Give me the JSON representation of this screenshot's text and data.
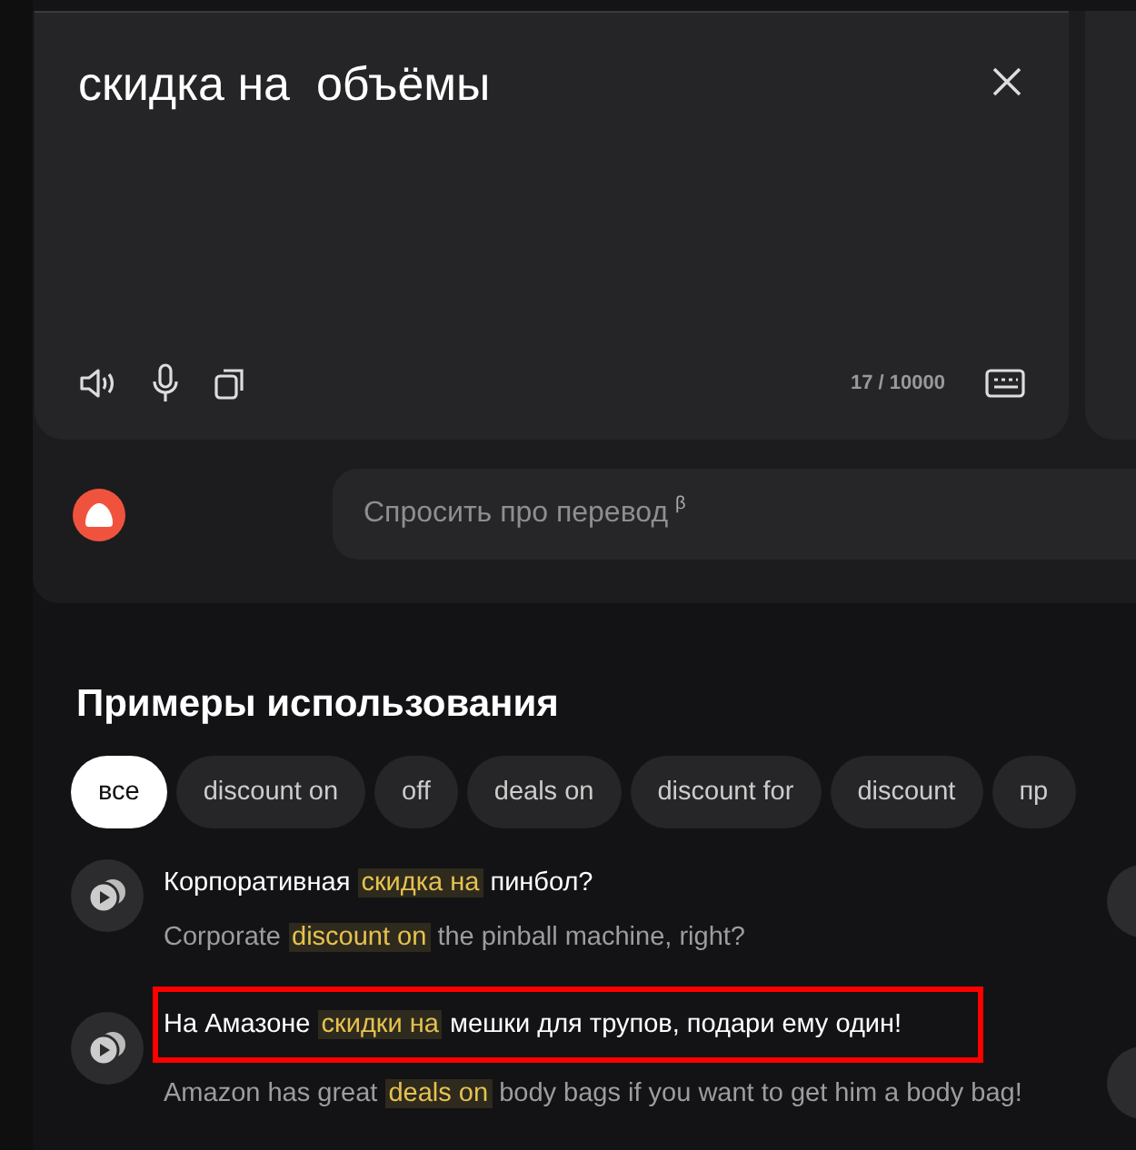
{
  "source": {
    "text": "скидка на  объёмы",
    "counter": "17 / 10000"
  },
  "assistant": {
    "placeholder": "Спросить про перевод",
    "mark": "β"
  },
  "examples_section": {
    "title": "Примеры использования",
    "filters": [
      {
        "label": "все",
        "selected": true
      },
      {
        "label": "discount on",
        "selected": false
      },
      {
        "label": "off",
        "selected": false
      },
      {
        "label": "deals on",
        "selected": false
      },
      {
        "label": "discount for",
        "selected": false
      },
      {
        "label": "discount",
        "selected": false
      },
      {
        "label": "пр",
        "selected": false
      }
    ],
    "examples": [
      {
        "highlighted": false,
        "source": [
          {
            "text": "Корпоративная ",
            "match": false
          },
          {
            "text": "скидка на",
            "match": true
          },
          {
            "text": " пинбол?",
            "match": false
          }
        ],
        "translation": [
          {
            "text": "Corporate ",
            "match": false
          },
          {
            "text": "discount on",
            "match": true
          },
          {
            "text": " the pinball machine, right?",
            "match": false
          }
        ]
      },
      {
        "highlighted": true,
        "source": [
          {
            "text": "На Амазоне ",
            "match": false
          },
          {
            "text": "скидки на",
            "match": true
          },
          {
            "text": " мешки для трупов, подари ему один!",
            "match": false
          }
        ],
        "translation": [
          {
            "text": "Amazon has great ",
            "match": false
          },
          {
            "text": "deals on",
            "match": true
          },
          {
            "text": " body bags if you want to get him a body bag!",
            "match": false
          }
        ]
      }
    ]
  }
}
